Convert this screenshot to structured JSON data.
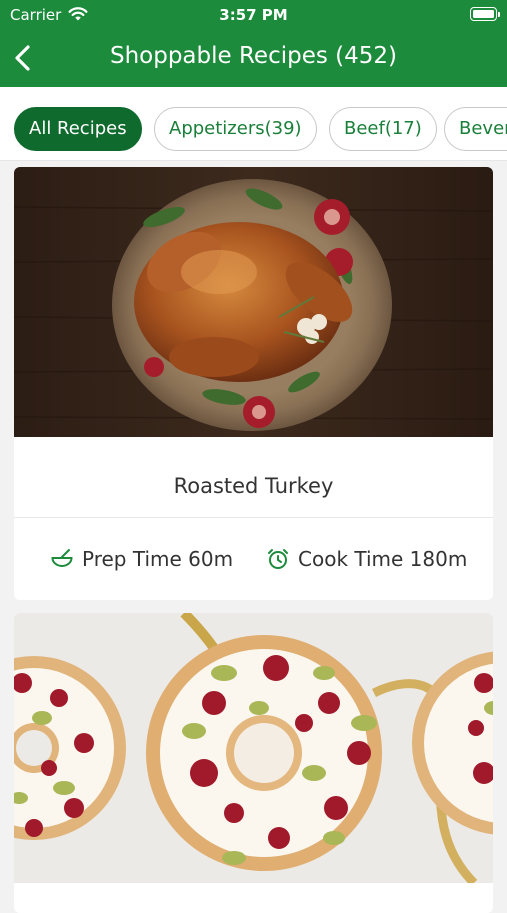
{
  "status_bar": {
    "carrier": "Carrier",
    "time": "3:57 PM"
  },
  "nav": {
    "title": "Shoppable Recipes (452)"
  },
  "filters": [
    {
      "label": "All Recipes",
      "active": true
    },
    {
      "label": "Appetizers(39)",
      "active": false
    },
    {
      "label": "Beef(17)",
      "active": false
    },
    {
      "label": "Bever",
      "active": false
    }
  ],
  "recipes": [
    {
      "title": "Roasted Turkey",
      "prep_time": "Prep Time 60m",
      "cook_time": "Cook Time 180m",
      "image": "roasted-turkey-photo"
    },
    {
      "title": "",
      "image": "frosted-wreath-cookies-photo"
    }
  ],
  "colors": {
    "brand_green": "#1c8b3c",
    "chip_active": "#0f6a2d",
    "chip_text": "#1a7f39"
  }
}
